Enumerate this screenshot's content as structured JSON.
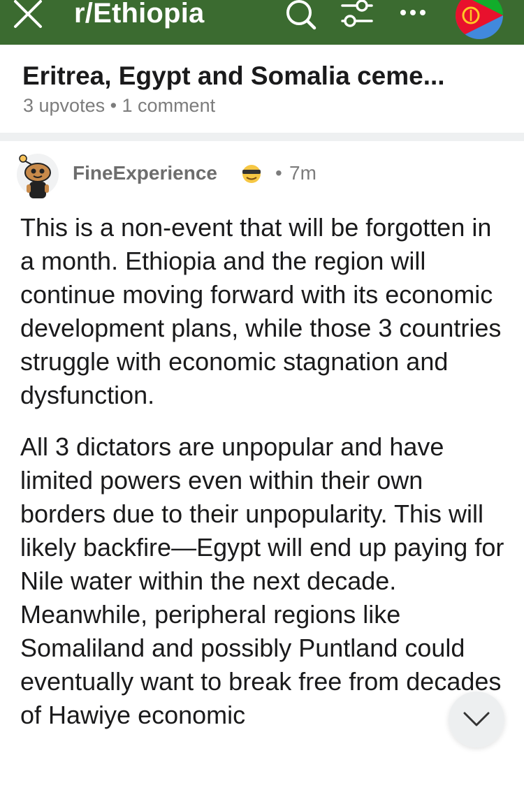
{
  "topbar": {
    "subreddit": "r/Ethiopia",
    "icons": [
      "close-icon",
      "search-icon",
      "filter-icon",
      "more-icon",
      "community-avatar"
    ],
    "background_color": "#3b6b30"
  },
  "post": {
    "title": "Eritrea, Egypt and Somalia ceme...",
    "meta": "3 upvotes • 1 comment"
  },
  "comment": {
    "username": "FineExperience",
    "separator": "•",
    "age": "7m",
    "paragraphs": [
      "This is a non-event that will be forgotten in a month. Ethiopia and the region will continue moving forward with its economic development plans, while those 3 countries struggle with economic stagnation and dysfunction.",
      "All 3 dictators are unpopular and have limited powers even within their own borders due to their unpopularity. This will likely backfire—Egypt will end up paying for Nile water within the next decade. Meanwhile, peripheral regions like Somaliland and possibly Puntland could eventually want to break free from decades of Hawiye economic"
    ]
  },
  "colors": {
    "meta_gray": "#7c7c7c",
    "divider": "#eef0f1"
  }
}
